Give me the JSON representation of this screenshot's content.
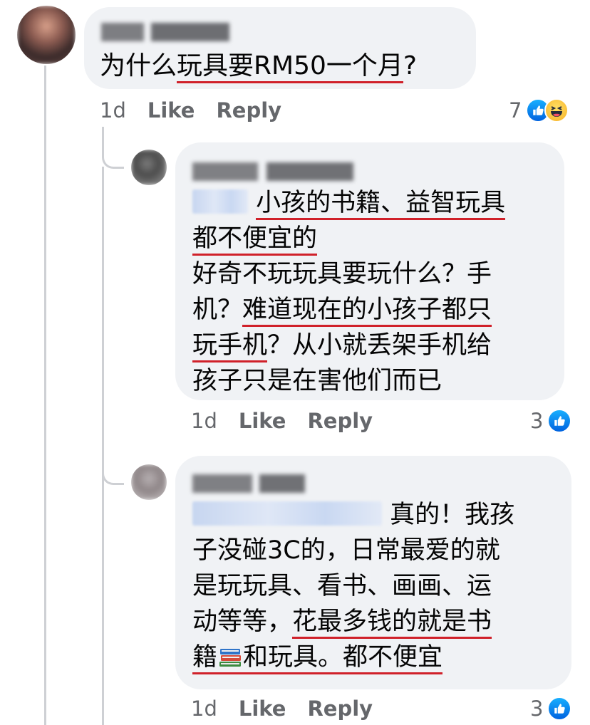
{
  "comments": [
    {
      "text_parts": [
        "为什么",
        "玩具要RM50一个月",
        "?"
      ],
      "time": "1d",
      "like_label": "Like",
      "reply_label": "Reply",
      "reaction_count": "7",
      "reactions": [
        "like-icon",
        "haha-icon"
      ]
    },
    {
      "lines": [
        [
          "小孩的书籍、益智玩具"
        ],
        [
          "都不便宜的"
        ],
        [
          "好奇不玩玩具要玩什么？手"
        ],
        [
          "机？",
          "难道现在的小孩子都只"
        ],
        [
          "玩手机",
          "？从小就丢架手机给"
        ],
        [
          "孩子只是在害他们而已"
        ]
      ],
      "time": "1d",
      "like_label": "Like",
      "reply_label": "Reply",
      "reaction_count": "3",
      "reactions": [
        "like-icon"
      ]
    },
    {
      "lines": [
        [
          "真的！我孩"
        ],
        [
          "子没碰3C的，日常最爱的就"
        ],
        [
          "是玩玩具、看书、画画、运"
        ],
        [
          "动等等，",
          "花最多钱的就是书"
        ],
        [
          "籍",
          "和玩具。都不便宜"
        ]
      ],
      "time": "1d",
      "like_label": "Like",
      "reply_label": "Reply",
      "reaction_count": "3",
      "reactions": [
        "like-icon"
      ]
    }
  ],
  "colors": {
    "bubble": "#f0f2f5",
    "underline": "#d0212a",
    "meta": "#65676b",
    "like_blue": "#1877f2"
  }
}
